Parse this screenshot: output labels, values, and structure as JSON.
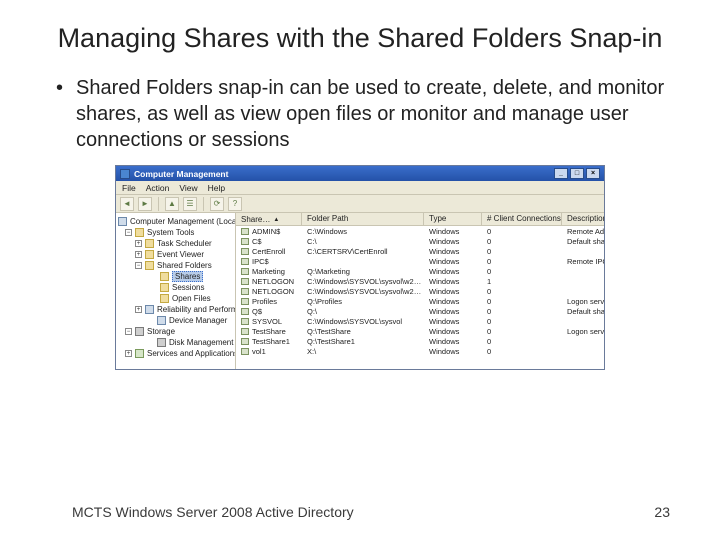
{
  "slide": {
    "title": "Managing Shares with the Shared Folders Snap-in",
    "bullet": "Shared Folders snap-in can be used to create, delete, and monitor shares, as well as view open files or monitor and manage user connections or sessions",
    "footer_text": "MCTS Windows Server 2008 Active Directory",
    "page_num": "23"
  },
  "window": {
    "title": "Computer Management",
    "min": "_",
    "max": "□",
    "close": "×"
  },
  "menu": {
    "file": "File",
    "action": "Action",
    "view": "View",
    "help": "Help"
  },
  "tree": {
    "root": "Computer Management (Local)",
    "system_tools": "System Tools",
    "task_scheduler": "Task Scheduler",
    "event_viewer": "Event Viewer",
    "shared_folders": "Shared Folders",
    "shares": "Shares",
    "sessions": "Sessions",
    "open_files": "Open Files",
    "reliability": "Reliability and Performanc",
    "device_mgr": "Device Manager",
    "storage": "Storage",
    "disk_mgmt": "Disk Management",
    "services_apps": "Services and Applications"
  },
  "columns": {
    "share_name": "Share…",
    "folder_path": "Folder Path",
    "type": "Type",
    "client_conn": "# Client Connections",
    "description": "Description"
  },
  "shares": [
    {
      "name": "ADMIN$",
      "path": "C:\\Windows",
      "type": "Windows",
      "conn": "0",
      "desc": "Remote Admin"
    },
    {
      "name": "C$",
      "path": "C:\\",
      "type": "Windows",
      "conn": "0",
      "desc": "Default share"
    },
    {
      "name": "CertEnroll",
      "path": "C:\\CERTSRV\\CertEnroll",
      "type": "Windows",
      "conn": "0",
      "desc": ""
    },
    {
      "name": "IPC$",
      "path": "",
      "type": "Windows",
      "conn": "0",
      "desc": "Remote IPC"
    },
    {
      "name": "Marketing",
      "path": "Q:\\Marketing",
      "type": "Windows",
      "conn": "0",
      "desc": ""
    },
    {
      "name": "NETLOGON",
      "path": "C:\\Windows\\SYSVOL\\sysvol\\w2…",
      "type": "Windows",
      "conn": "1",
      "desc": ""
    },
    {
      "name": "NETLOGON",
      "path": "C:\\Windows\\SYSVOL\\sysvol\\w2…",
      "type": "Windows",
      "conn": "0",
      "desc": ""
    },
    {
      "name": "Profiles",
      "path": "Q:\\Profiles",
      "type": "Windows",
      "conn": "0",
      "desc": "Logon server share"
    },
    {
      "name": "Q$",
      "path": "Q:\\",
      "type": "Windows",
      "conn": "0",
      "desc": "Default share"
    },
    {
      "name": "SYSVOL",
      "path": "C:\\Windows\\SYSVOL\\sysvol",
      "type": "Windows",
      "conn": "0",
      "desc": ""
    },
    {
      "name": "TestShare",
      "path": "Q:\\TestShare",
      "type": "Windows",
      "conn": "0",
      "desc": "Logon server share"
    },
    {
      "name": "TestShare1",
      "path": "Q:\\TestShare1",
      "type": "Windows",
      "conn": "0",
      "desc": ""
    },
    {
      "name": "vol1",
      "path": "X:\\",
      "type": "Windows",
      "conn": "0",
      "desc": ""
    }
  ]
}
